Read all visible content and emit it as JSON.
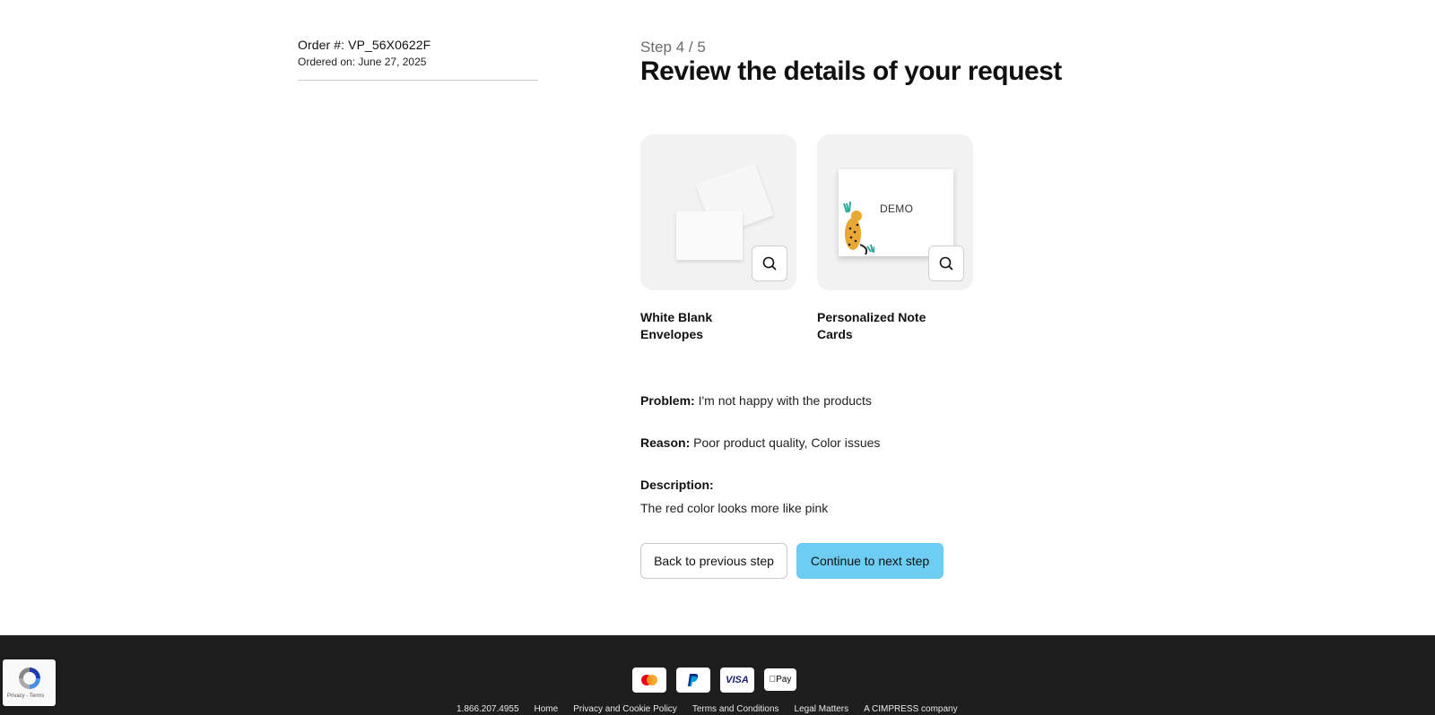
{
  "order": {
    "number": "Order #: VP_56X0622F",
    "date": "Ordered on: June 27, 2025"
  },
  "header": {
    "step": "Step 4 / 5",
    "title": "Review the details of your request"
  },
  "products": [
    {
      "name": "White Blank Envelopes",
      "zoom_icon": "magnifier-icon"
    },
    {
      "name": "Personalized Note Cards",
      "card_text": "DEMO",
      "zoom_icon": "magnifier-icon"
    }
  ],
  "details": {
    "problem_label": "Problem:",
    "problem_value": "I'm not happy with the products",
    "reason_label": "Reason:",
    "reason_value": "Poor product quality, Color issues",
    "description_label": "Description:",
    "description_value": "The red color looks more like pink"
  },
  "buttons": {
    "back": "Back to previous step",
    "next": "Continue to next step"
  },
  "footer": {
    "payments": [
      "mastercard-icon",
      "paypal-icon",
      "visa-icon",
      "apple-pay-icon"
    ],
    "visa_text": "VISA",
    "applepay_text": "Pay",
    "links": {
      "phone": "1.866.207.4955",
      "home": "Home",
      "privacy": "Privacy and Cookie Policy",
      "terms": "Terms and Conditions",
      "legal": "Legal Matters",
      "company": "A CIMPRESS company"
    }
  },
  "recaptcha": {
    "text": "Privacy - Terms"
  },
  "colors": {
    "accent": "#6dcdf3",
    "footer_bg": "#1e1e1e",
    "thumb_bg": "#f2f2f2"
  }
}
